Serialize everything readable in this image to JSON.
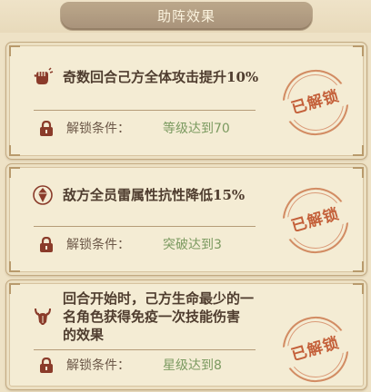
{
  "header": {
    "title": "助阵效果"
  },
  "cards": [
    {
      "icon": "fist-icon",
      "effect": "奇数回合己方全体攻击提升10%",
      "condition_label": "解锁条件：",
      "condition_value": "等级达到70",
      "stamp": "已解锁"
    },
    {
      "icon": "gem-icon",
      "effect": "敌方全员雷属性抗性降低15%",
      "condition_label": "解锁条件：",
      "condition_value": "突破达到3",
      "stamp": "已解锁"
    },
    {
      "icon": "horned-helmet-icon",
      "effect_lines": [
        "回合开始时，己方生命最少的一",
        "名角色获得免疫一次技能伤害",
        "的效果"
      ],
      "condition_label": "解锁条件：",
      "condition_value": "星级达到8",
      "stamp": "已解锁"
    }
  ],
  "colors": {
    "background": "#eee2c6",
    "card": "#f4ecd4",
    "effect_text": "#4f3d2f",
    "condition_value": "#7b9a60",
    "stamp": "#c0552d"
  }
}
